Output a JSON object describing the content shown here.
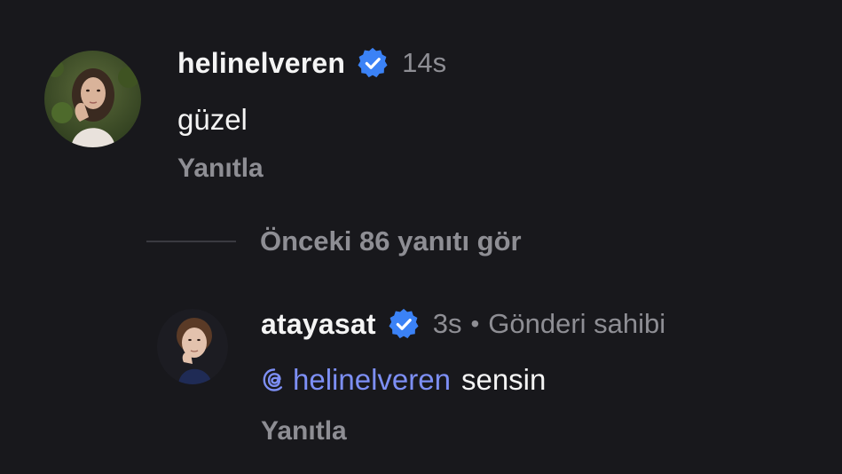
{
  "comments": [
    {
      "username": "helinelveren",
      "verified": true,
      "time": "14s",
      "text": "güzel",
      "reply_label": "Yanıtla"
    },
    {
      "username": "atayasat",
      "verified": true,
      "time": "3s",
      "separator": "•",
      "author_tag": "Gönderi sahibi",
      "mention": "helinelveren",
      "text": "sensin",
      "reply_label": "Yanıtla"
    }
  ],
  "thread": {
    "view_previous_label": "Önceki 86 yanıtı gör"
  },
  "colors": {
    "background": "#18181c",
    "primary_text": "#f4f4f4",
    "secondary_text": "#8e8e94",
    "mention": "#7d8ff5",
    "verified_badge": "#3b82f6"
  },
  "icons": {
    "verified": "verified-badge-icon",
    "mention": "threads-at-icon"
  }
}
